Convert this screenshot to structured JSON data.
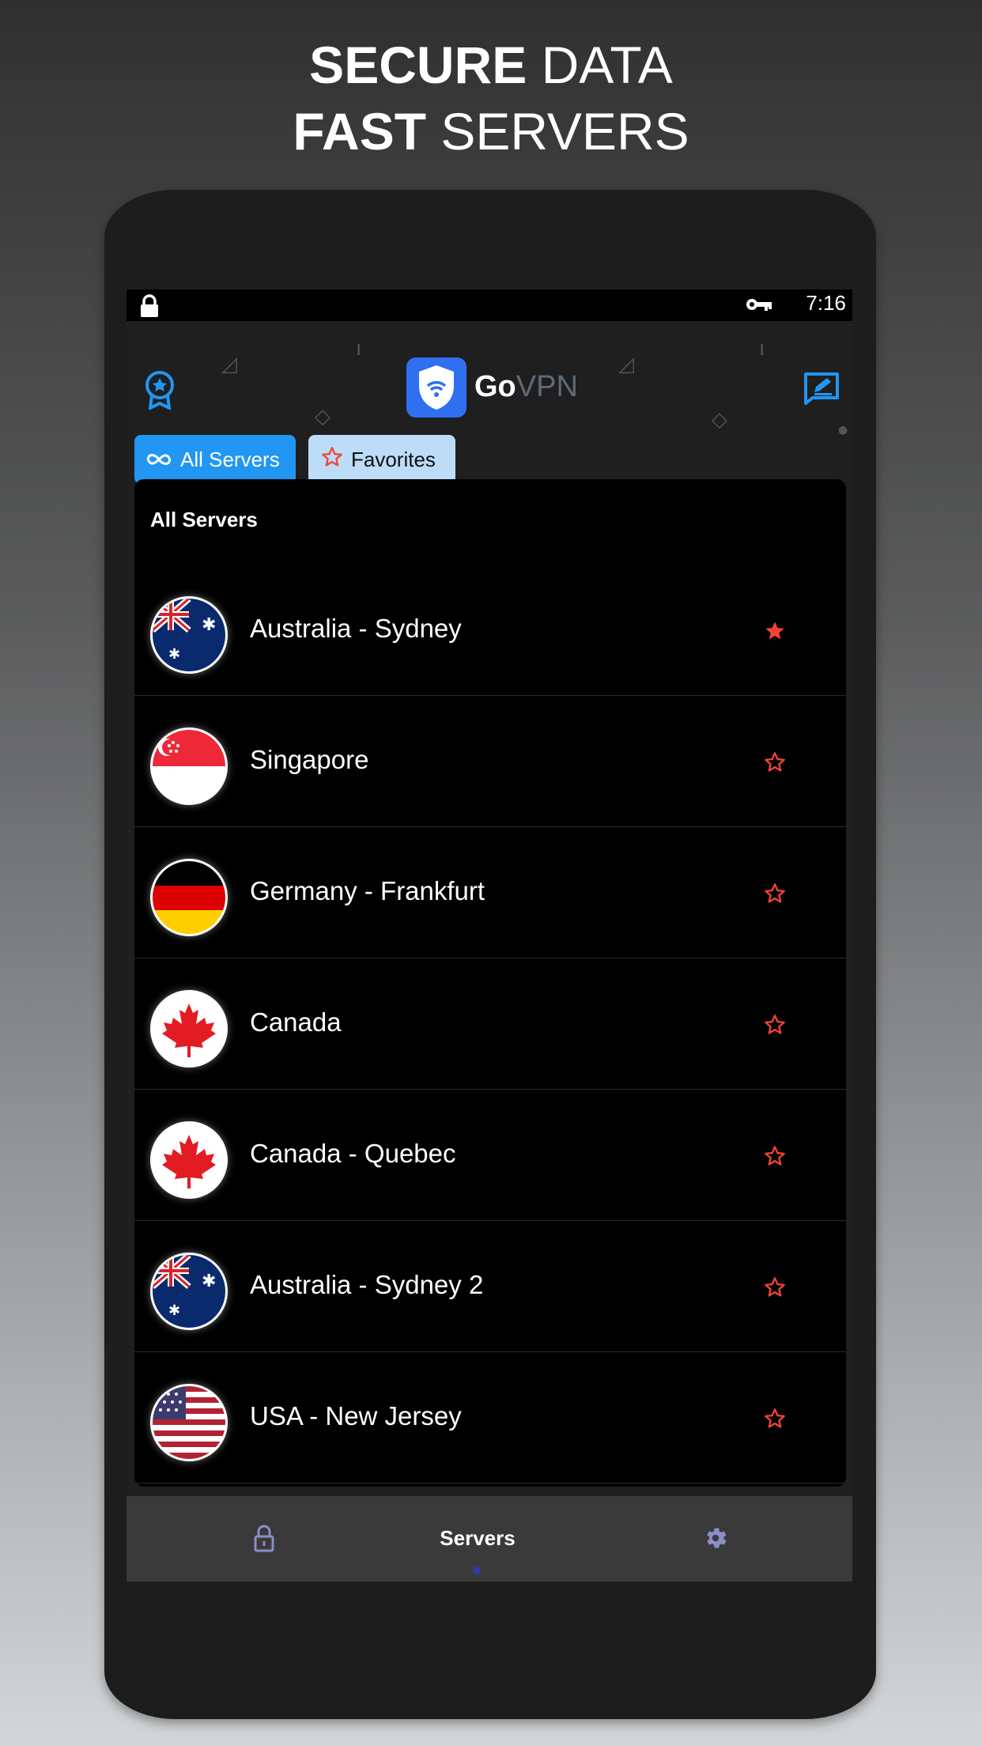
{
  "promo": {
    "line1_bold": "SECURE",
    "line1_light": "DATA",
    "line2_bold": "FAST",
    "line2_light": "SERVERS"
  },
  "status_bar": {
    "time": "7:16",
    "icons": [
      "lock-icon",
      "vpn-key-icon"
    ]
  },
  "app_bar": {
    "brand_go": "Go",
    "brand_vpn": "VPN",
    "left_icon": "award-badge-icon",
    "right_icon": "edit-message-icon"
  },
  "tabs": [
    {
      "label": "All Servers",
      "icon": "infinity-icon",
      "active": true
    },
    {
      "label": "Favorites",
      "icon": "star-outline-icon",
      "active": false
    }
  ],
  "server_list": {
    "title": "All Servers",
    "items": [
      {
        "name": "Australia - Sydney",
        "flag": "australia",
        "favorite": true
      },
      {
        "name": "Singapore",
        "flag": "singapore",
        "favorite": false
      },
      {
        "name": "Germany - Frankfurt",
        "flag": "germany",
        "favorite": false
      },
      {
        "name": "Canada",
        "flag": "canada",
        "favorite": false
      },
      {
        "name": "Canada - Quebec",
        "flag": "canada",
        "favorite": false
      },
      {
        "name": "Australia - Sydney 2",
        "flag": "australia",
        "favorite": false
      },
      {
        "name": "USA - New Jersey",
        "flag": "usa",
        "favorite": false
      }
    ]
  },
  "bottom_nav": {
    "items": [
      {
        "label": "",
        "icon": "lock-open-icon"
      },
      {
        "label": "Servers",
        "icon": "",
        "active": true
      },
      {
        "label": "",
        "icon": "settings-gear-icon"
      }
    ]
  },
  "colors": {
    "accent": "#2196f3",
    "star": "#f44336",
    "brand_blue": "#2f6ff0"
  }
}
